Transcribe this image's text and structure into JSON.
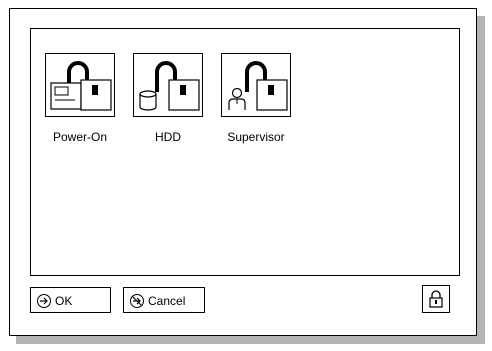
{
  "password_items": [
    {
      "label": "Power-On",
      "icon": "power-on-lock-icon"
    },
    {
      "label": "HDD",
      "icon": "hdd-lock-icon"
    },
    {
      "label": "Supervisor",
      "icon": "supervisor-lock-icon"
    }
  ],
  "buttons": {
    "ok_label": "OK",
    "cancel_label": "Cancel",
    "ok_icon": "arrow-right-circle-icon",
    "cancel_icon": "cancel-arrow-circle-icon",
    "lock_icon": "padlock-icon"
  }
}
